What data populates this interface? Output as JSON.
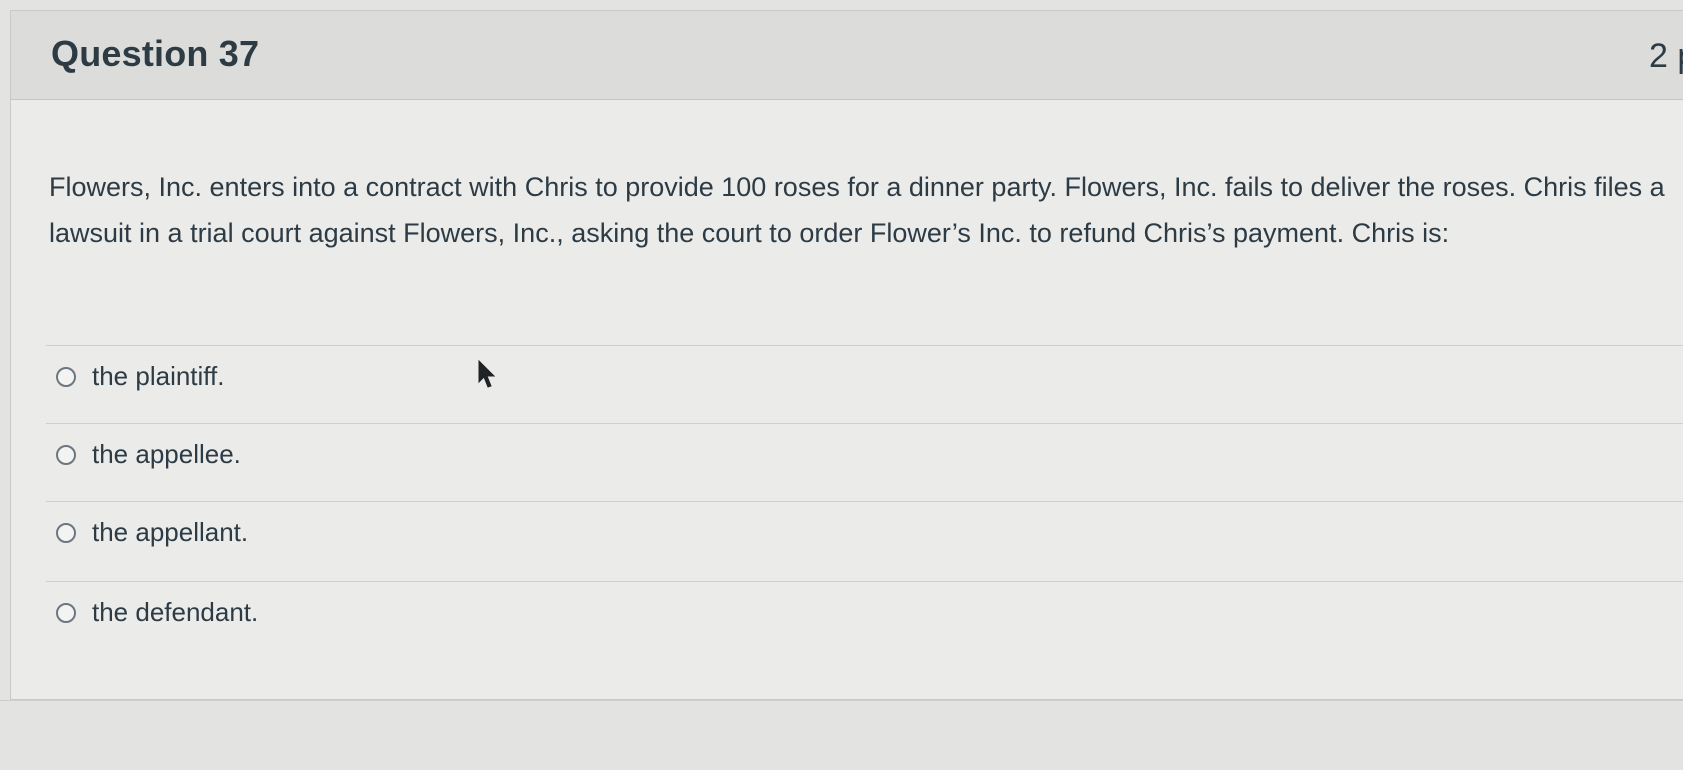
{
  "question": {
    "title": "Question 37",
    "points": "2 p",
    "text": "Flowers, Inc. enters into a contract with Chris to provide 100 roses for a dinner party. Flowers, Inc. fails to deliver the roses. Chris files a lawsuit in a trial court against Flowers, Inc., asking the court to order Flower’s Inc. to refund Chris’s payment. Chris is:"
  },
  "answers": [
    {
      "label": "the plaintiff."
    },
    {
      "label": "the appellee."
    },
    {
      "label": "the appellant."
    },
    {
      "label": "the defendant."
    }
  ],
  "icons": {
    "radio": "radio-unchecked-icon",
    "cursor": "mouse-pointer-icon"
  },
  "colors": {
    "text": "#2d3b45",
    "header_bg": "#dcdcdb",
    "card_bg": "#ebebea"
  }
}
